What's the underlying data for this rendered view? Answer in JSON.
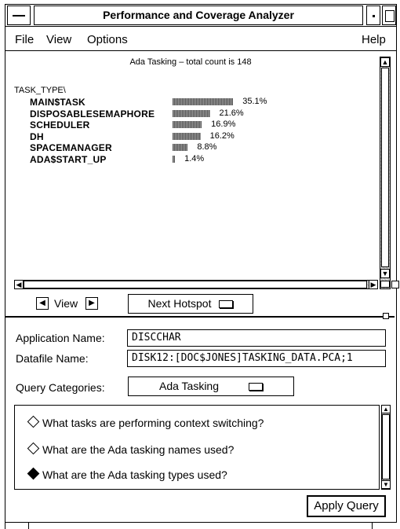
{
  "window": {
    "title": "Performance and Coverage Analyzer"
  },
  "menubar": {
    "file": "File",
    "view": "View",
    "options": "Options",
    "help": "Help"
  },
  "plot": {
    "title": "Ada Tasking – total count is 148",
    "group_label": "TASK_TYPE\\",
    "rows": [
      {
        "name": "MAIN$TASK",
        "pct": "35.1%",
        "value": 35.1
      },
      {
        "name": "DISPOSABLESEMAPHORE",
        "pct": "21.6%",
        "value": 21.6
      },
      {
        "name": "SCHEDULER",
        "pct": "16.9%",
        "value": 16.9
      },
      {
        "name": "DH",
        "pct": "16.2%",
        "value": 16.2
      },
      {
        "name": "SPACEMANAGER",
        "pct": "8.8%",
        "value": 8.8
      },
      {
        "name": "ADA$START_UP",
        "pct": "1.4%",
        "value": 1.4
      }
    ]
  },
  "nav": {
    "view_label": "View",
    "hotspot_label": "Next Hotspot"
  },
  "form": {
    "app_label": "Application Name:",
    "app_value": "DISCCHAR",
    "datafile_label": "Datafile Name:",
    "datafile_value": "DISK12:[DOC$JONES]TASKING_DATA.PCA;1",
    "category_label": "Query Categories:",
    "category_value": "Ada Tasking"
  },
  "queries": [
    {
      "text": "What tasks are performing context switching?",
      "selected": false
    },
    {
      "text": "What are the Ada tasking names used?",
      "selected": false
    },
    {
      "text": "What are the Ada tasking types used?",
      "selected": true
    }
  ],
  "apply_label": "Apply Query"
}
